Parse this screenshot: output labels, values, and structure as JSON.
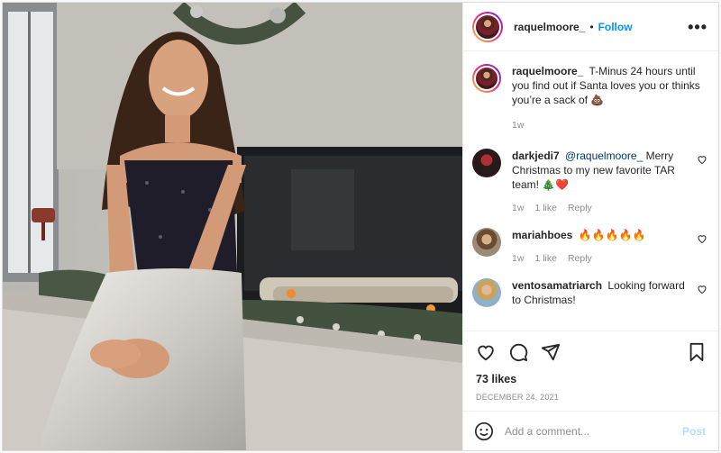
{
  "post": {
    "username": "raquelmoore_",
    "follow_label": "Follow",
    "more_label": "•••"
  },
  "caption": {
    "username": "raquelmoore_",
    "text": "T-Minus 24 hours until you find out if Santa loves you or thinks you’re a sack of 💩",
    "time": "1w"
  },
  "comments": [
    {
      "username": "darkjedi7",
      "mention": "@raquelmoore_",
      "text": "Merry Christmas to my new favorite TAR team! 🎄❤️",
      "time": "1w",
      "likes": "1 like",
      "reply": "Reply"
    },
    {
      "username": "mariahboes",
      "mention": "",
      "text": "🔥🔥🔥🔥🔥",
      "time": "1w",
      "likes": "1 like",
      "reply": "Reply"
    },
    {
      "username": "ventosamatriarch",
      "mention": "",
      "text": "Looking forward to Christmas!"
    }
  ],
  "likes_count": "73 likes",
  "date": "DECEMBER 24, 2021",
  "add_comment": {
    "placeholder": "Add a comment...",
    "post_label": "Post"
  },
  "icons": {
    "heart": "heart-icon",
    "comment": "comment-icon",
    "share": "share-icon",
    "save": "bookmark-icon",
    "emoji": "emoji-icon",
    "more": "more-icon"
  },
  "colors": {
    "follow": "#0095f6",
    "post_disabled": "#b2dffc",
    "muted": "#8e8e8e"
  }
}
